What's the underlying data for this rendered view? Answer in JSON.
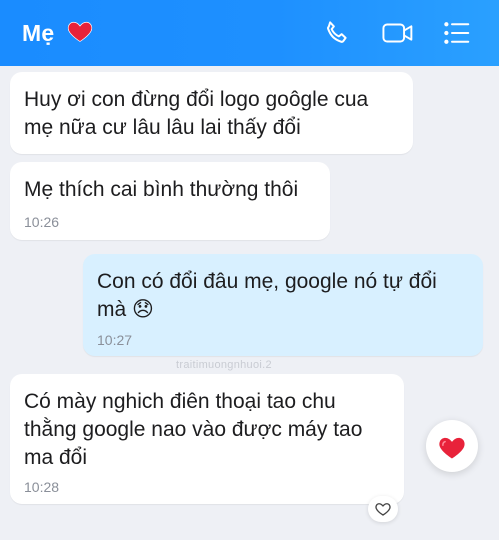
{
  "header": {
    "contact_name": "Mẹ",
    "heart_icon": "red-heart-emoji",
    "actions": [
      "phone-icon",
      "video-call-icon",
      "menu-icon"
    ],
    "accent_color": "#1e90ff"
  },
  "messages": [
    {
      "direction": "incoming",
      "text": "Huy ơi con đừng đổi logo goôgle cua mẹ nữa cư lâu lâu lai thấy đổi",
      "time": ""
    },
    {
      "direction": "incoming",
      "text": "Mẹ thích cai bình thường thôi",
      "time": "10:26"
    },
    {
      "direction": "outgoing",
      "text": "Con có đổi đâu mẹ, google nó tự đổi mà 😞",
      "time": "10:27"
    },
    {
      "direction": "incoming",
      "text": "Có mày nghich điên thoại tao chu thằng google nao vào được máy tao ma đổi",
      "time": "10:28",
      "reaction": "red-heart"
    }
  ],
  "watermark": "traitimuongnhuoi.2",
  "colors": {
    "incoming_bubble": "#ffffff",
    "outgoing_bubble": "#d8f0ff",
    "background": "#eef0f5"
  }
}
